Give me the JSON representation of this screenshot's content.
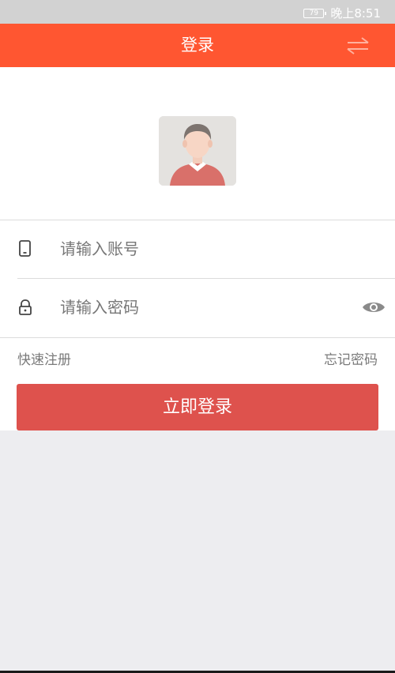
{
  "status_bar": {
    "battery": "79",
    "time": "晚上8:51"
  },
  "header": {
    "title": "登录",
    "switch_icon": "swap-arrows-icon"
  },
  "avatar": {
    "icon": "user-avatar-icon"
  },
  "form": {
    "account": {
      "placeholder": "请输入账号",
      "value": "",
      "icon": "phone-icon"
    },
    "password": {
      "placeholder": "请输入密码",
      "value": "",
      "icon": "lock-icon",
      "toggle_icon": "eye-icon"
    }
  },
  "links": {
    "register": "快速注册",
    "forgot": "忘记密码"
  },
  "login_button": "立即登录",
  "colors": {
    "header_bg": "#ff5631",
    "button_bg": "#de524d",
    "page_bg": "#ededf0"
  }
}
